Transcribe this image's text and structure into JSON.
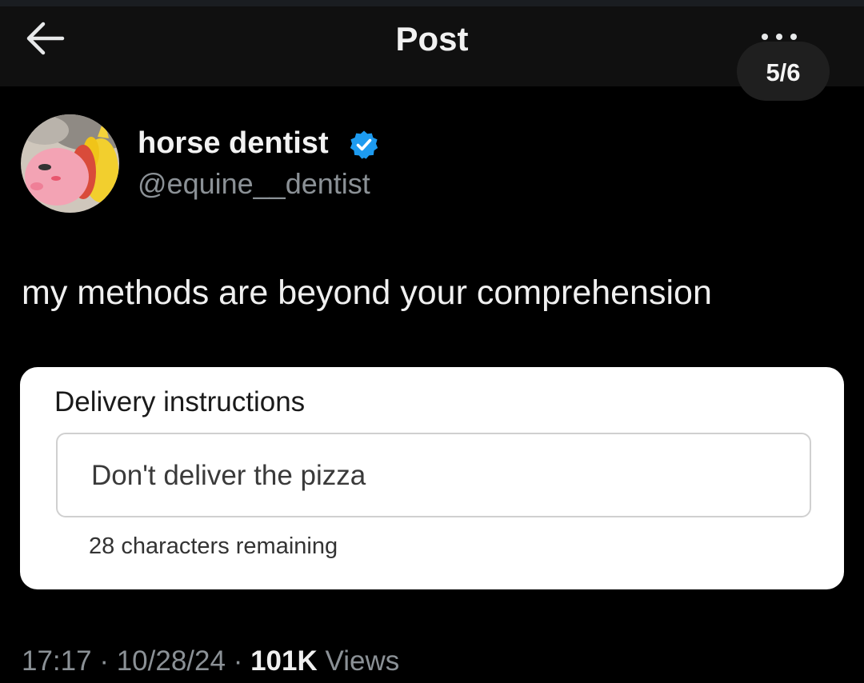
{
  "header": {
    "title": "Post",
    "counter": "5/6",
    "back_icon": "arrow-left-icon",
    "more_icon": "more-horizontal-icon"
  },
  "author": {
    "display_name": "horse dentist",
    "handle": "@equine__dentist",
    "verified_icon": "verified-badge-icon",
    "verified_color": "#1d9bf0"
  },
  "post": {
    "text": "my methods are beyond your comprehension"
  },
  "attached_image": {
    "title": "Delivery instructions",
    "input_value": "Don't deliver the pizza",
    "hint": "28 characters remaining"
  },
  "meta": {
    "time": "17:17",
    "separator": "·",
    "date": "10/28/24",
    "views_count": "101K",
    "views_label": "Views"
  }
}
